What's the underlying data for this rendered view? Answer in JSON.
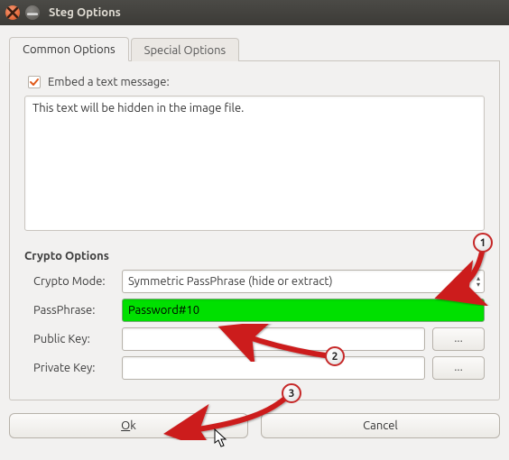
{
  "window": {
    "title": "Steg Options"
  },
  "tabs": {
    "common": "Common Options",
    "special": "Special Options"
  },
  "embed": {
    "checkbox_label": "Embed a text message:",
    "text_value": "This text will be hidden in the image file."
  },
  "crypto": {
    "header": "Crypto Options",
    "mode_label": "Crypto Mode:",
    "mode_value": "Symmetric PassPhrase (hide or extract)",
    "pass_label": "PassPhrase:",
    "pass_value": "Password#10",
    "pubkey_label": "Public Key:",
    "pubkey_value": "",
    "privkey_label": "Private Key:",
    "privkey_value": "",
    "browse_label": "..."
  },
  "buttons": {
    "ok": "Ok",
    "cancel": "Cancel"
  },
  "annotations": {
    "b1": "1",
    "b2": "2",
    "b3": "3"
  }
}
